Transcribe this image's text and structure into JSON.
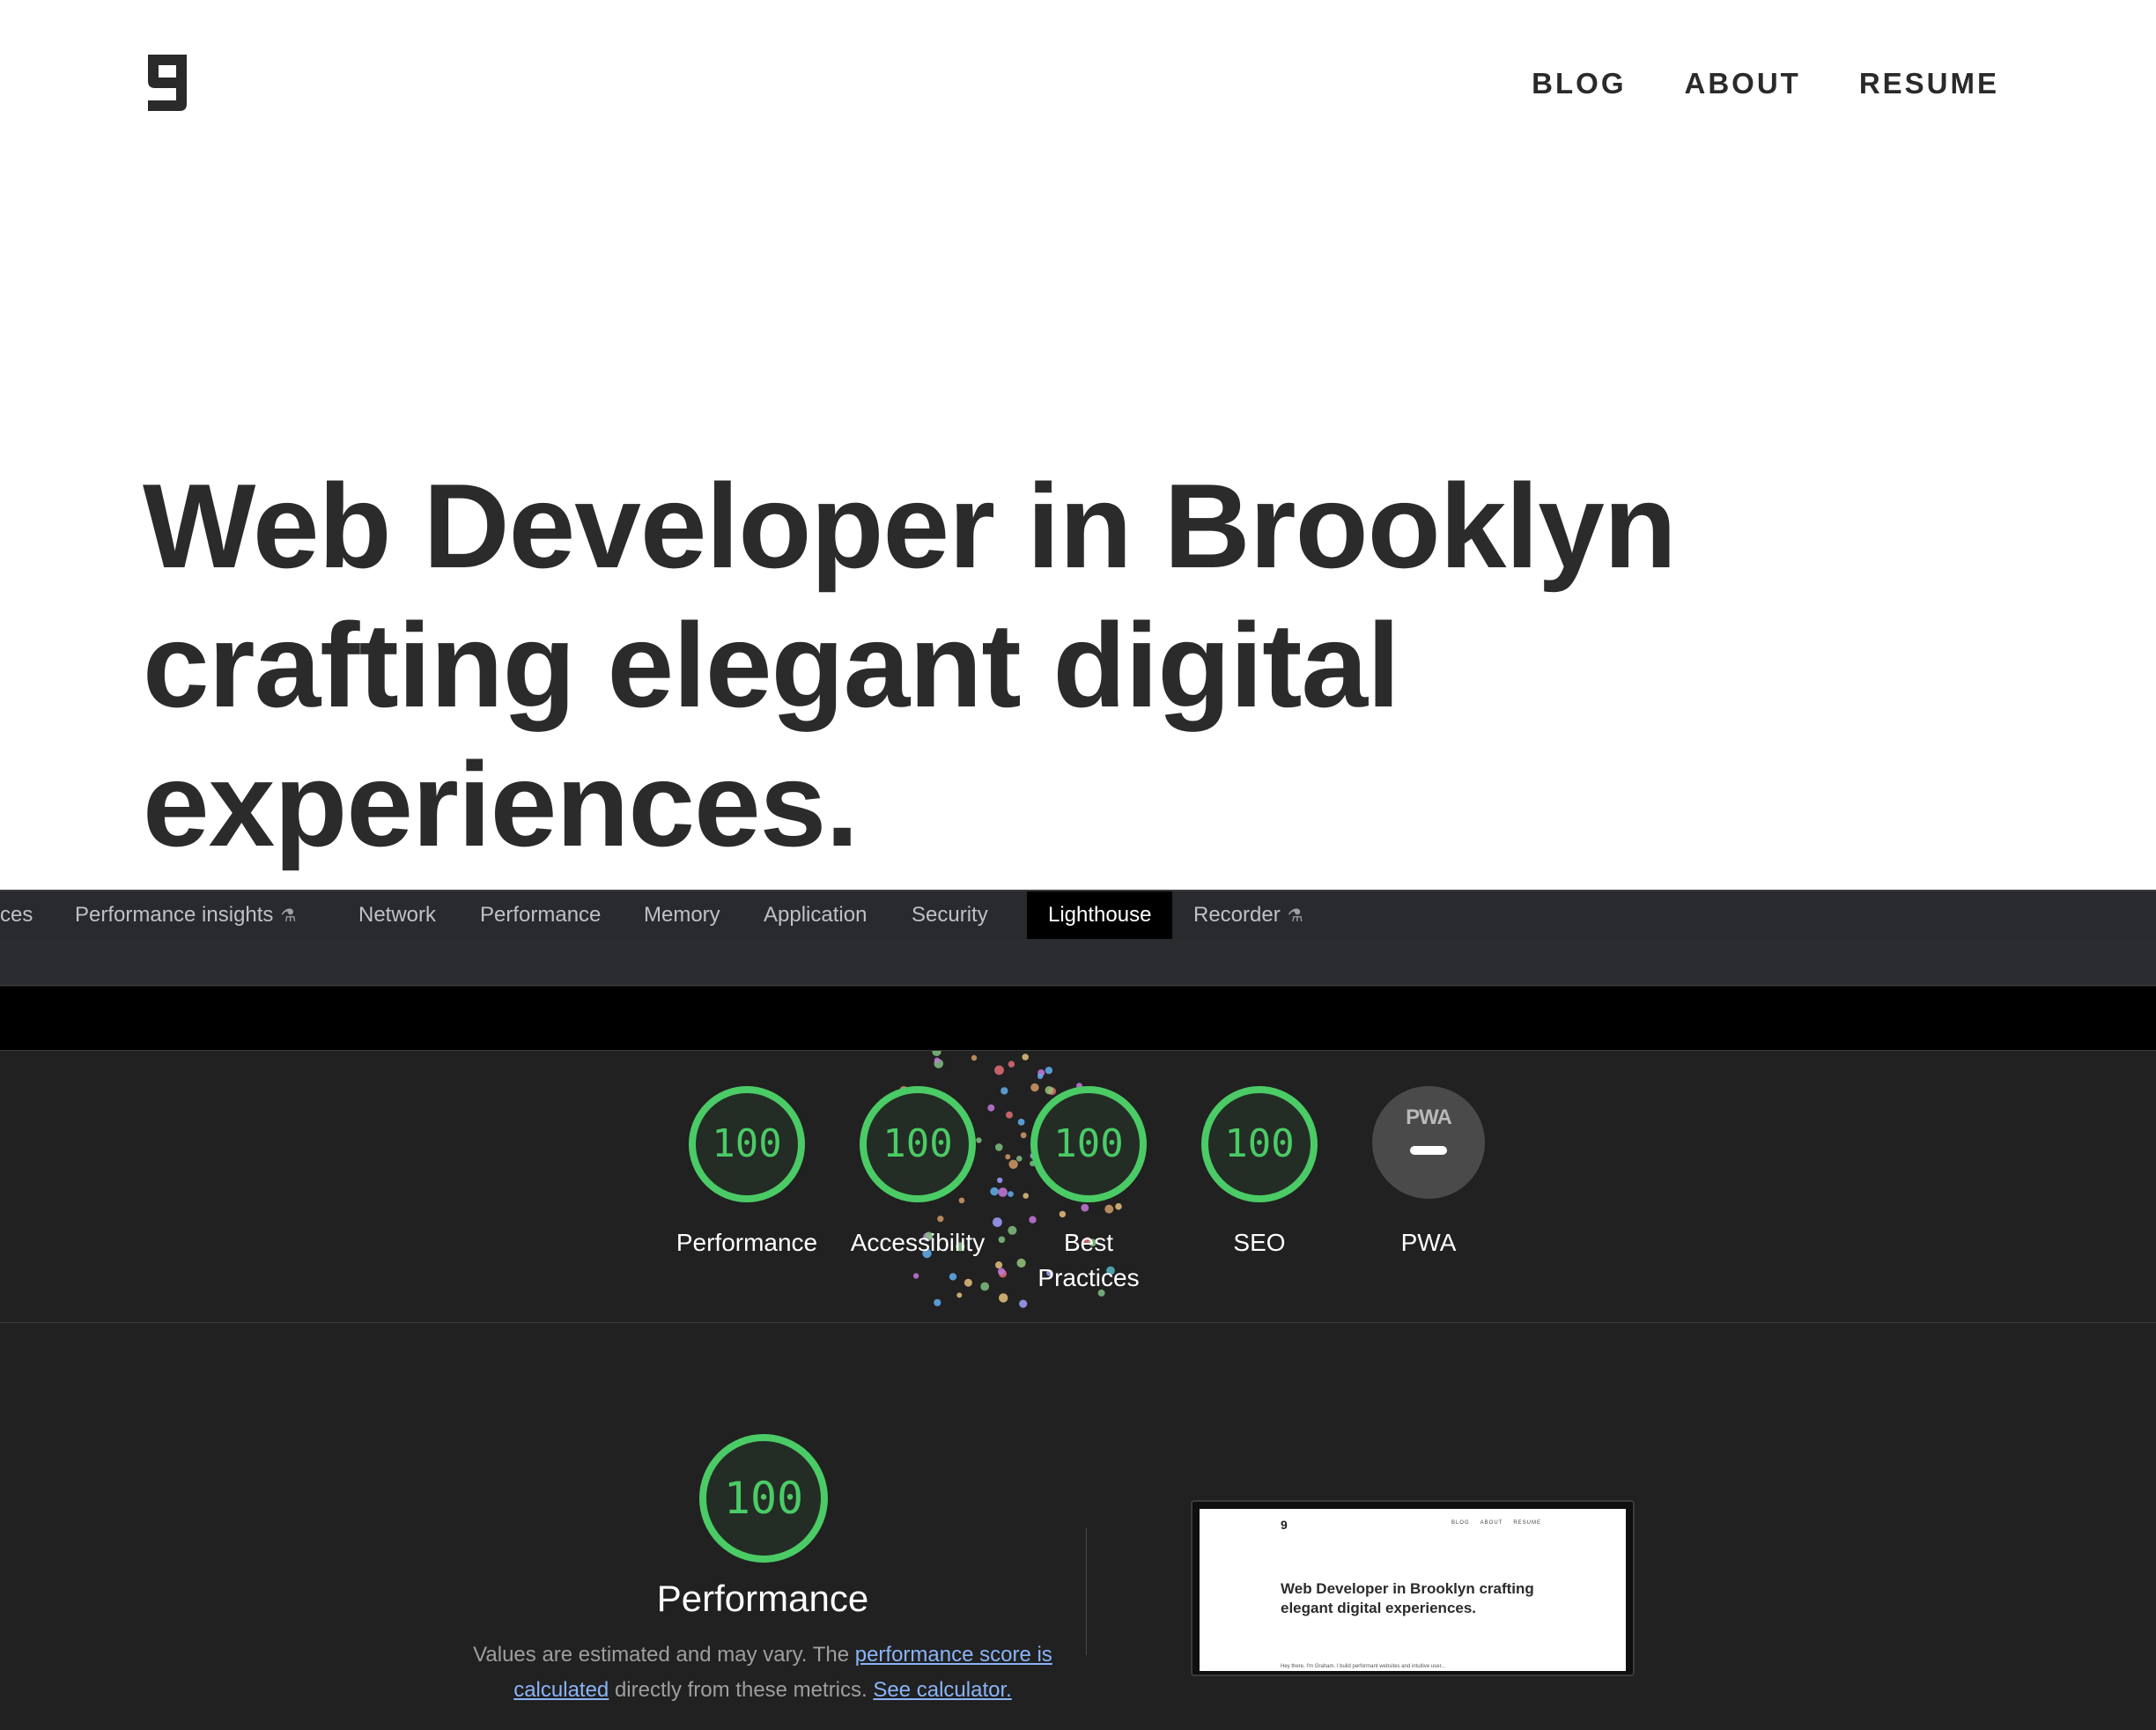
{
  "site": {
    "logo_alt": "9",
    "nav": [
      "BLOG",
      "ABOUT",
      "RESUME"
    ],
    "hero_title": "Web Developer in Brooklyn crafting elegant digital experiences."
  },
  "devtools": {
    "tabs": [
      "ces",
      "Performance insights",
      "Network",
      "Performance",
      "Memory",
      "Application",
      "Security",
      "Lighthouse",
      "Recorder"
    ],
    "active_tab": "Lighthouse",
    "scores": [
      {
        "label": "Performance",
        "value": "100"
      },
      {
        "label": "Accessibility",
        "value": "100"
      },
      {
        "label": "Best Practices",
        "value": "100"
      },
      {
        "label": "SEO",
        "value": "100"
      }
    ],
    "pwa": {
      "badge": "PWA",
      "label": "PWA"
    },
    "performance_detail": {
      "score": "100",
      "title": "Performance",
      "desc_pre": "Values are estimated and may vary. The ",
      "link1": "performance score is calculated",
      "desc_mid": " directly from these metrics. ",
      "link2": "See calculator."
    },
    "thumbnail": {
      "logo": "9",
      "nav": [
        "BLOG",
        "ABOUT",
        "RESUME"
      ],
      "title": "Web Developer in Brooklyn crafting elegant digital experiences.",
      "footer": "Hey there, I'm Graham. I build performant websites and intuitive user..."
    }
  },
  "colors": {
    "score_green": "#4bcb66",
    "link_blue": "#8ab4f8",
    "devtools_bg": "#202124"
  }
}
